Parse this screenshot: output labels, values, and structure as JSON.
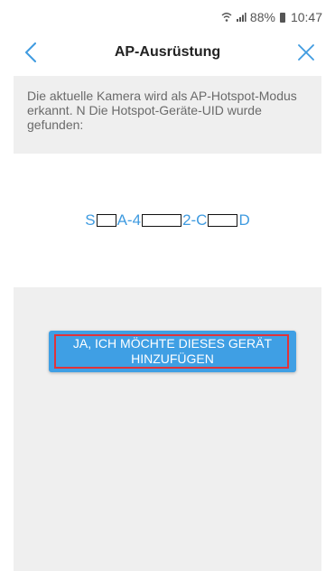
{
  "status_bar": {
    "battery": "88%",
    "time": "10:47",
    "icons": [
      "wifi-icon",
      "signal-icon",
      "battery-icon"
    ]
  },
  "nav": {
    "title": "AP-Ausrüstung",
    "back_icon": "chevron-left-icon",
    "close_icon": "close-icon"
  },
  "info": {
    "text": "Die aktuelle Kamera wird als AP-Hotspot-Modus erkannt.  N Die Hotspot-Geräte-UID wurde gefunden:"
  },
  "uid": {
    "parts": [
      "S",
      "A-4",
      "2-C",
      "D"
    ]
  },
  "add_button": {
    "label": "JA, ICH MÖCHTE DIESES GERÄT HINZUFÜGEN"
  },
  "colors": {
    "accent": "#3f9fe4",
    "highlight": "#e0333a",
    "panel": "#efefef"
  }
}
